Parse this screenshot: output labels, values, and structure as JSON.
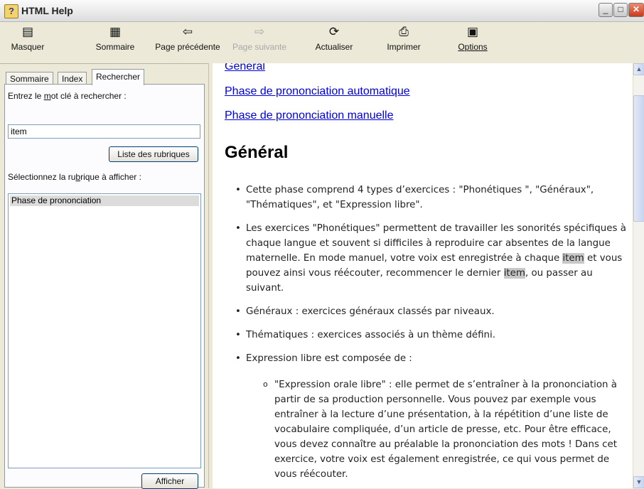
{
  "window": {
    "title": "HTML Help"
  },
  "toolbar": {
    "hide": "Masquer",
    "contents": "Sommaire",
    "back": "Page précédente",
    "forward": "Page suivante",
    "refresh": "Actualiser",
    "print": "Imprimer",
    "options": "Options"
  },
  "tabs": {
    "contents": "Sommaire",
    "index": "Index",
    "search": "Rechercher"
  },
  "search": {
    "label_pre": "Entrez le ",
    "label_u": "m",
    "label_post": "ot clé à rechercher :",
    "value": "item",
    "list_topics_button": "Liste des rubriques",
    "select_label_pre": "Sélectionnez la ru",
    "select_label_u": "b",
    "select_label_post": "rique à afficher :",
    "results": [
      "Phase de prononciation"
    ],
    "display_button": "Afficher"
  },
  "content": {
    "links": [
      "Général",
      "Phase de prononciation automatique",
      "Phase de prononciation manuelle"
    ],
    "heading": "Général",
    "b1": "Cette phase comprend  4 types d’exercices : \"Phonétiques \", \"Généraux\", \"Thématiques\", et \"Expression libre\".",
    "b2_part1": "Les exercices \"Phonétiques\" permettent de travailler les sonorités spécifiques à chaque langue et souvent si difficiles à reproduire car absentes de la langue maternelle. En mode manuel, votre voix est enregistrée à chaque ",
    "b2_hl1": "item",
    "b2_part2": " et vous pouvez ainsi vous réécouter, recommencer le dernier ",
    "b2_hl2": "item",
    "b2_part3": ", ou passer au suivant.",
    "b3": "Généraux : exercices généraux classés par niveaux.",
    "b4": "Thématiques : exercices associés à un thème défini.",
    "b5": "Expression libre est composée de :",
    "sub1": "\"Expression orale libre\" : elle permet de s’entraîner à la prononciation à partir de sa production personnelle. Vous pouvez par exemple vous entraîner à la lecture d’une présentation, à la répétition d’une liste de vocabulaire compliquée, d’un article de presse, etc. Pour être efficace, vous devez connaître au préalable la prononciation des mots ! Dans cet exercice, votre voix est également enregistrée, ce qui vous permet de vous réécouter."
  }
}
